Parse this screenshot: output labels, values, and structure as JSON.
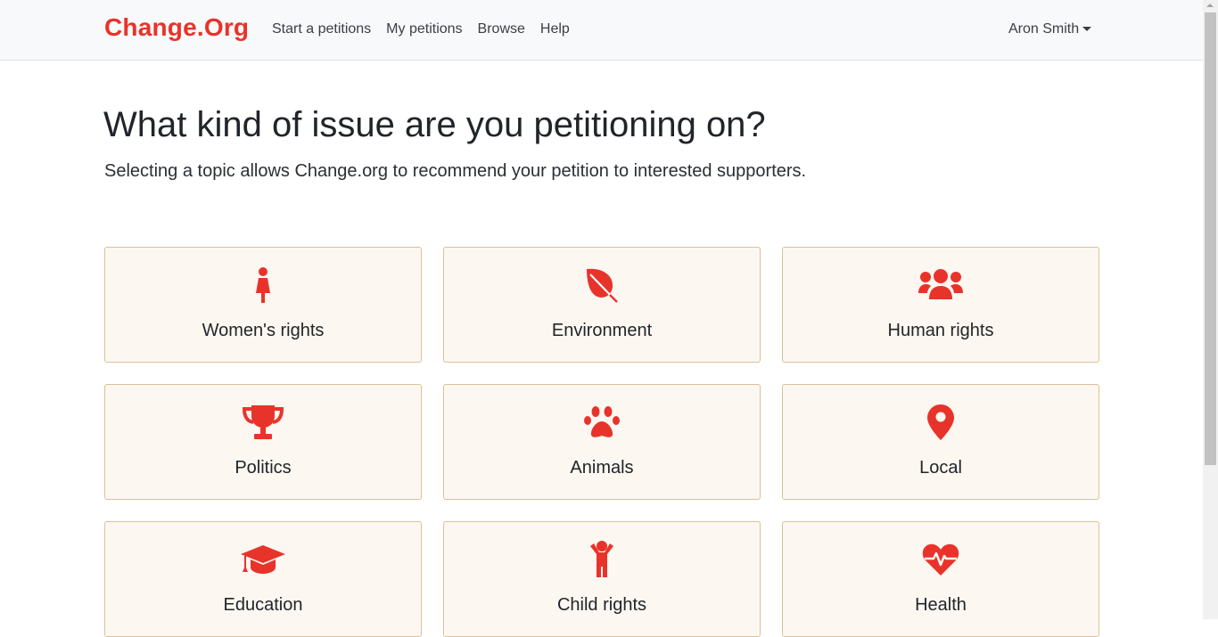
{
  "header": {
    "brand": "Change.Org",
    "nav": [
      {
        "label": "Start a petitions"
      },
      {
        "label": "My petitions"
      },
      {
        "label": "Browse"
      },
      {
        "label": "Help"
      }
    ],
    "user_name": "Aron Smith"
  },
  "main": {
    "title": "What kind of issue are you petitioning on?",
    "subtitle": "Selecting a topic allows Change.org to recommend your petition to interested supporters."
  },
  "topics": [
    {
      "label": "Women's rights",
      "icon": "female-icon"
    },
    {
      "label": "Environment",
      "icon": "leaf-icon"
    },
    {
      "label": "Human rights",
      "icon": "users-icon"
    },
    {
      "label": "Politics",
      "icon": "trophy-icon"
    },
    {
      "label": "Animals",
      "icon": "paw-icon"
    },
    {
      "label": "Local",
      "icon": "map-marker-icon"
    },
    {
      "label": "Education",
      "icon": "graduation-cap-icon"
    },
    {
      "label": "Child rights",
      "icon": "child-icon"
    },
    {
      "label": "Health",
      "icon": "heartbeat-icon"
    }
  ],
  "colors": {
    "brand": "#e8332b",
    "card_background": "#fdf7f1",
    "card_border": "#d9c29a",
    "icon": "#e8332b"
  }
}
